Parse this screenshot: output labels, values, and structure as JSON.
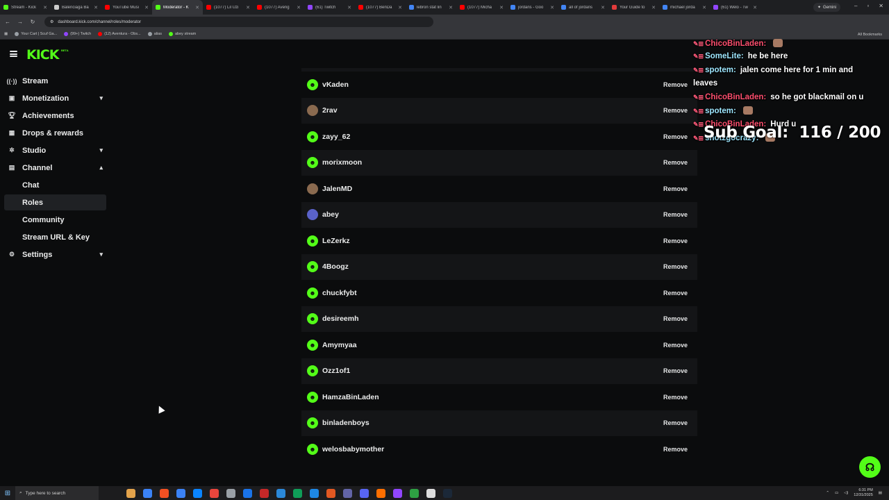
{
  "browser": {
    "tabs": [
      {
        "label": "Stream - Kick",
        "color": "#53fc18"
      },
      {
        "label": "Balenciaga Ba",
        "color": "#cccccc"
      },
      {
        "label": "YouTube Musi",
        "color": "#ff0000"
      },
      {
        "label": "Moderator - K",
        "color": "#53fc18",
        "active": true
      },
      {
        "label": "(1077) Lil Uzi",
        "color": "#ff0000"
      },
      {
        "label": "(1077) Aveng",
        "color": "#ff0000"
      },
      {
        "label": "(61) Twitch",
        "color": "#9146ff"
      },
      {
        "label": "(1077) BenDa",
        "color": "#ff0000"
      },
      {
        "label": "lebron stat lin",
        "color": "#4285f4"
      },
      {
        "label": "(1077) Micha",
        "color": "#ff0000"
      },
      {
        "label": "jordans - Goo",
        "color": "#4285f4"
      },
      {
        "label": "all of jordans",
        "color": "#4285f4"
      },
      {
        "label": "Your Guide to",
        "color": "#e23b3b"
      },
      {
        "label": "michael jorda",
        "color": "#4285f4"
      },
      {
        "label": "(61) Welo - Tw",
        "color": "#9146ff"
      }
    ],
    "gemini_label": "Gemini",
    "url": "dashboard.kick.com/channel/roles/moderator",
    "bookmarks": [
      {
        "label": "Your Cart | Scuf Ga...",
        "color": "#9aa0a6"
      },
      {
        "label": "(99+) Twitch",
        "color": "#9146ff"
      },
      {
        "label": "(12) Aventura - Obs...",
        "color": "#ff0000"
      },
      {
        "label": "alias",
        "color": "#9aa0a6"
      },
      {
        "label": "abey stream",
        "color": "#53fc18"
      }
    ],
    "all_bookmarks": "All Bookmarks"
  },
  "kick": {
    "logo": "KICK",
    "beta": "BETA",
    "accent": "#53fc18"
  },
  "sidebar": {
    "items": [
      {
        "label": "Stream",
        "icon": "broadcast-icon",
        "glyph": "((·))",
        "chevron": ""
      },
      {
        "label": "Monetization",
        "icon": "dollar-icon",
        "glyph": "▣",
        "chevron": "▾"
      },
      {
        "label": "Achievements",
        "icon": "trophy-icon",
        "glyph": "🏆︎",
        "chevron": ""
      },
      {
        "label": "Drops & rewards",
        "icon": "gift-icon",
        "glyph": "▦",
        "chevron": ""
      },
      {
        "label": "Studio",
        "icon": "settings-cog-icon",
        "glyph": "✲",
        "chevron": "▾"
      },
      {
        "label": "Channel",
        "icon": "channel-icon",
        "glyph": "▤",
        "chevron": "▴"
      },
      {
        "label": "Chat",
        "sub": true
      },
      {
        "label": "Roles",
        "sub": true,
        "selected": true
      },
      {
        "label": "Community",
        "sub": true
      },
      {
        "label": "Stream URL & Key",
        "sub": true
      },
      {
        "label": "Settings",
        "icon": "gear-icon",
        "glyph": "⚙",
        "chevron": "▾"
      }
    ]
  },
  "moderators": {
    "remove_label": "Remove",
    "rows": [
      {
        "name": "vKaden",
        "avatar": "green"
      },
      {
        "name": "2rav",
        "avatar": "photo"
      },
      {
        "name": "zayy_62",
        "avatar": "green"
      },
      {
        "name": "morixmoon",
        "avatar": "green"
      },
      {
        "name": "JalenMD",
        "avatar": "photo"
      },
      {
        "name": "abey",
        "avatar": "blue"
      },
      {
        "name": "LeZerkz",
        "avatar": "green"
      },
      {
        "name": "4Boogz",
        "avatar": "green"
      },
      {
        "name": "chuckfybt",
        "avatar": "green"
      },
      {
        "name": "desireemh",
        "avatar": "green"
      },
      {
        "name": "Amymyaa",
        "avatar": "green"
      },
      {
        "name": "Ozz1of1",
        "avatar": "green"
      },
      {
        "name": "HamzaBinLaden",
        "avatar": "green"
      },
      {
        "name": "binladenboys",
        "avatar": "green"
      },
      {
        "name": "welosbabymother",
        "avatar": "green"
      }
    ]
  },
  "chat_overlay": {
    "messages": [
      {
        "user": "ChicoBinLaden:",
        "text": "",
        "color": "red",
        "emote": true
      },
      {
        "user": "SomeLite:",
        "text": "he be here",
        "color": "cyan"
      },
      {
        "user": "spotem:",
        "text": "jalen come here for 1 min and",
        "color": "cyan"
      },
      {
        "user": "",
        "text": "leaves",
        "color": "cyan"
      },
      {
        "user": "ChicoBinLaden:",
        "text": "so he got blackmail on u",
        "color": "red"
      },
      {
        "user": "spotem:",
        "text": "",
        "color": "cyan",
        "emote": true
      },
      {
        "user": "ChicoBinLaden:",
        "text": "Hurd u",
        "color": "red"
      },
      {
        "user": "shotzgocrazy:",
        "text": "",
        "color": "cyan",
        "emote": true
      }
    ],
    "sub_goal_label": "Sub Goal:",
    "sub_goal_current": "116",
    "sub_goal_target": "200"
  },
  "taskbar": {
    "search_placeholder": "Type here to search",
    "time": "6:31 PM",
    "date": "12/31/2025"
  }
}
